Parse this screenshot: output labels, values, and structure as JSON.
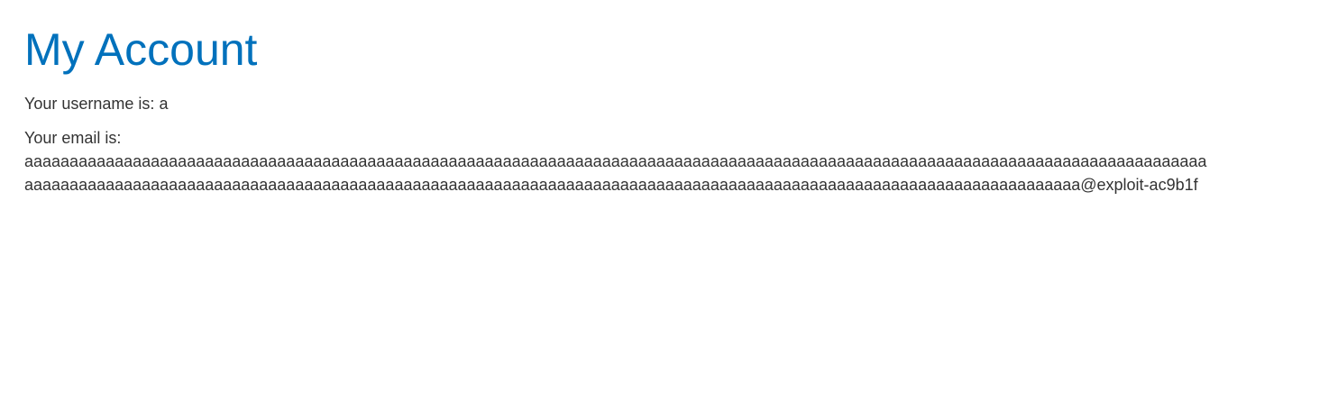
{
  "page": {
    "title": "My Account",
    "username_label": "Your username is:",
    "username_value": "a",
    "email_label": "Your email is:",
    "email_value_line1": "aaaaaaaaaaaaaaaaaaaaaaaaaaaaaaaaaaaaaaaaaaaaaaaaaaaaaaaaaaaaaaaaaaaaaaaaaaaaaaaaaaaaaaaaaaaaaaaaaaaaaaaaaaaaaaaaaaaaaaaaaaaaaaaaaaa",
    "email_value_line2": "aaaaaaaaaaaaaaaaaaaaaaaaaaaaaaaaaaaaaaaaaaaaaaaaaaaaaaaaaaaaaaaaaaaaaaaaaaaaaaaaaaaaaaaaaaaaaaaaaaaaaaaaaaaaaaaaaaaaa@exploit-ac9b1f"
  },
  "colors": {
    "title": "#0071bc",
    "text": "#333333",
    "background": "#ffffff"
  }
}
